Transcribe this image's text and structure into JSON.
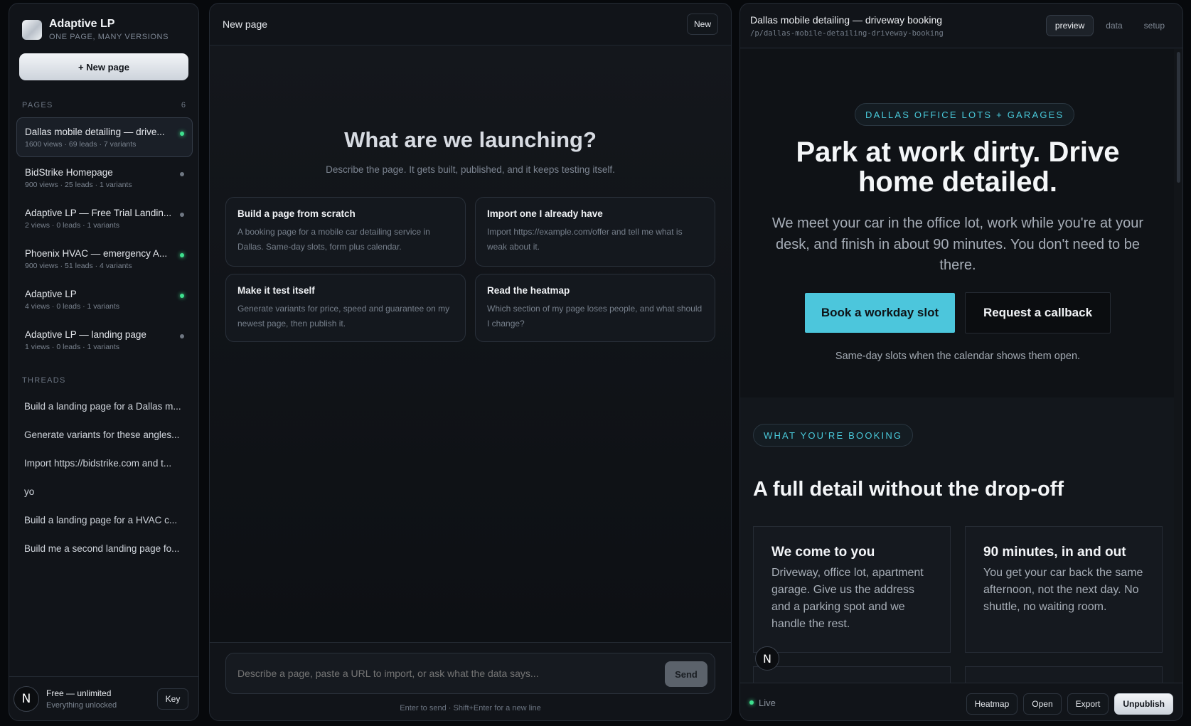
{
  "brand": {
    "name": "Adaptive LP",
    "tagline": "ONE PAGE, MANY VERSIONS",
    "new_page_label": "+ New page"
  },
  "pages": {
    "label": "PAGES",
    "count": "6",
    "items": [
      {
        "title": "Dallas mobile detailing — drive...",
        "meta": "1600 views · 69 leads · 7 variants",
        "live": true,
        "active": true
      },
      {
        "title": "BidStrike Homepage",
        "meta": "900 views · 25 leads · 1 variants",
        "live": false,
        "active": false
      },
      {
        "title": "Adaptive LP — Free Trial Landin...",
        "meta": "2 views · 0 leads · 1 variants",
        "live": false,
        "active": false
      },
      {
        "title": "Phoenix HVAC — emergency A...",
        "meta": "900 views · 51 leads · 4 variants",
        "live": true,
        "active": false
      },
      {
        "title": "Adaptive LP",
        "meta": "4 views · 0 leads · 1 variants",
        "live": true,
        "active": false
      },
      {
        "title": "Adaptive LP — landing page",
        "meta": "1 views · 0 leads · 1 variants",
        "live": false,
        "active": false
      }
    ]
  },
  "threads": {
    "label": "THREADS",
    "items": [
      "Build a landing page for a Dallas m...",
      "Generate variants for these angles...",
      "Import https://bidstrike.com and t...",
      "yo",
      "Build a landing page for a HVAC c...",
      "Build me a second landing page fo..."
    ]
  },
  "account": {
    "avatar_letter": "N",
    "plan": "Free — unlimited",
    "plan_sub": "Everything unlocked",
    "key_label": "Key"
  },
  "center": {
    "title": "New page",
    "new_label": "New",
    "headline": "What are we launching?",
    "subline": "Describe the page. It gets built, published, and it keeps testing itself.",
    "cards": [
      {
        "title": "Build a page from scratch",
        "desc": "A booking page for a mobile car detailing service in Dallas. Same-day slots, form plus calendar."
      },
      {
        "title": "Import one I already have",
        "desc": "Import https://example.com/offer and tell me what is weak about it."
      },
      {
        "title": "Make it test itself",
        "desc": "Generate variants for price, speed and guarantee on my newest page, then publish it."
      },
      {
        "title": "Read the heatmap",
        "desc": "Which section of my page loses people, and what should I change?"
      }
    ],
    "composer_placeholder": "Describe a page, paste a URL to import, or ask what the data says...",
    "send_label": "Send",
    "hint": "Enter to send · Shift+Enter for a new line"
  },
  "preview": {
    "title": "Dallas mobile detailing — driveway booking",
    "slug": "/p/dallas-mobile-detailing-driveway-booking",
    "tabs": [
      "preview",
      "data",
      "setup"
    ],
    "active_tab": "preview",
    "status": "Live",
    "actions": [
      "Heatmap",
      "Open",
      "Export",
      "Unpublish"
    ],
    "floating_letter": "N"
  },
  "landing": {
    "eyebrow": "DALLAS OFFICE LOTS + GARAGES",
    "headline": "Park at work dirty. Drive home detailed.",
    "lead": "We meet your car in the office lot, work while you're at your desk, and finish in about 90 minutes. You don't need to be there.",
    "cta_primary": "Book a workday slot",
    "cta_secondary": "Request a callback",
    "cta_note": "Same-day slots when the calendar shows them open.",
    "section_eyebrow": "WHAT YOU'RE BOOKING",
    "section_title": "A full detail without the drop-off",
    "features": [
      {
        "title": "We come to you",
        "desc": "Driveway, office lot, apartment garage. Give us the address and a parking spot and we handle the rest."
      },
      {
        "title": "90 minutes, in and out",
        "desc": "You get your car back the same afternoon, not the next day. No shuttle, no waiting room."
      }
    ]
  },
  "colors": {
    "accent": "#4cc6dc",
    "live": "#3ee08e",
    "background": "#07090c",
    "panel": "#111419"
  }
}
